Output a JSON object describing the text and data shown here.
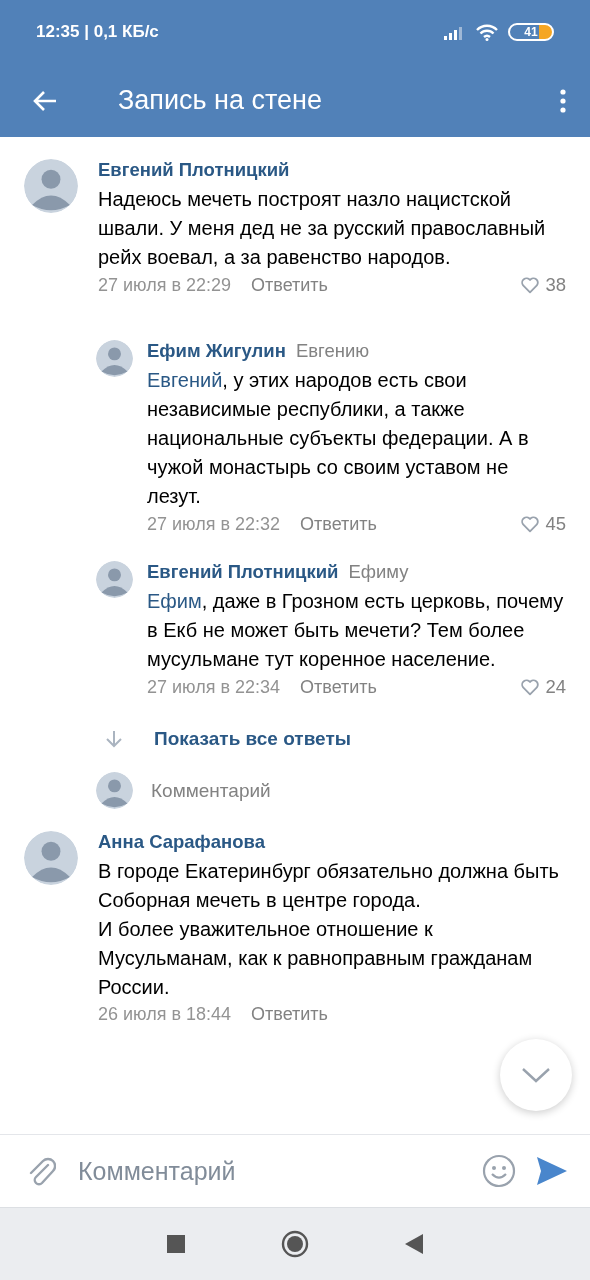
{
  "status_bar": {
    "time": "12:35 | 0,1 КБ/с",
    "battery": "41"
  },
  "app_bar": {
    "title": "Запись на стене"
  },
  "comments": [
    {
      "author": "Евгений Плотницкий",
      "text": "Надеюсь мечеть построят назло нацистской швали. У меня дед не за русский православный рейх воевал, а за равенство народов.",
      "date": "27 июля в 22:29",
      "reply_label": "Ответить",
      "likes": "38",
      "replies": [
        {
          "author": "Ефим Жигулин",
          "reply_to": "Евгению",
          "mention": "Евгений",
          "text": ", у этих народов есть свои независимые республики, а также национальные субъекты федерации. А в чужой монастырь со своим уставом не лезут.",
          "date": "27 июля в 22:32",
          "reply_label": "Ответить",
          "likes": "45"
        },
        {
          "author": "Евгений Плотницкий",
          "reply_to": "Ефиму",
          "mention": "Ефим",
          "text": ", даже в Грозном есть церковь, почему в Екб не может быть мечети? Тем более мусульмане тут коренное население.",
          "date": "27 июля в 22:34",
          "reply_label": "Ответить",
          "likes": "24"
        }
      ],
      "show_all_replies": "Показать все ответы",
      "reply_placeholder": "Комментарий"
    },
    {
      "author": "Анна Сарафанова",
      "text": "В городе Екатеринбург обязательно должна быть Соборная мечеть в центре города.\nИ более уважительное отношение к  Мусульманам, как к равноправным гражданам России.",
      "date": "26 июля в 18:44",
      "reply_label": "Ответить"
    }
  ],
  "composer": {
    "placeholder": "Комментарий"
  }
}
